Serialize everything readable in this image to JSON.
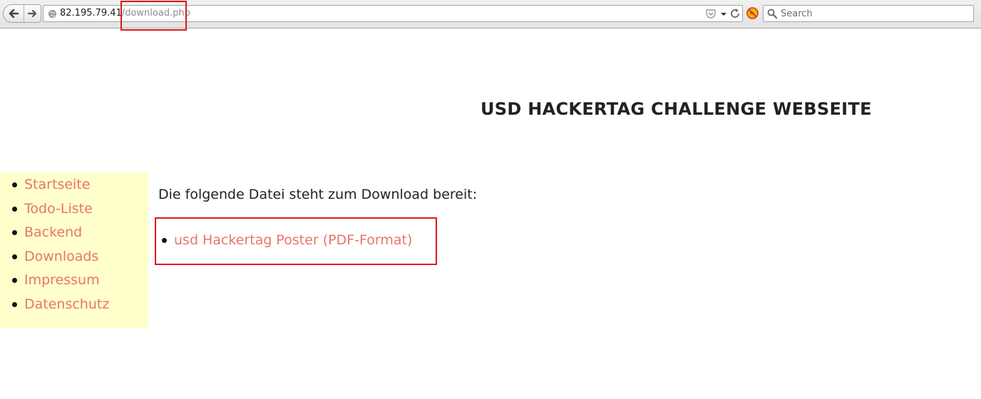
{
  "browser": {
    "url_host": "82.195.79.41",
    "url_path": "/download.php",
    "search_placeholder": "Search"
  },
  "page": {
    "title": "USD HACKERTAG CHALLENGE WEBSEITE",
    "intro": "Die folgende Datei steht zum Download bereit:",
    "download_link": "usd Hackertag Poster (PDF-Format)"
  },
  "sidebar": {
    "items": [
      {
        "label": "Startseite"
      },
      {
        "label": "Todo-Liste"
      },
      {
        "label": "Backend"
      },
      {
        "label": "Downloads"
      },
      {
        "label": "Impressum"
      },
      {
        "label": "Datenschutz"
      }
    ]
  },
  "colors": {
    "link": "#e8756b",
    "sidebar_bg": "#ffffcc",
    "highlight": "#e0161b"
  }
}
